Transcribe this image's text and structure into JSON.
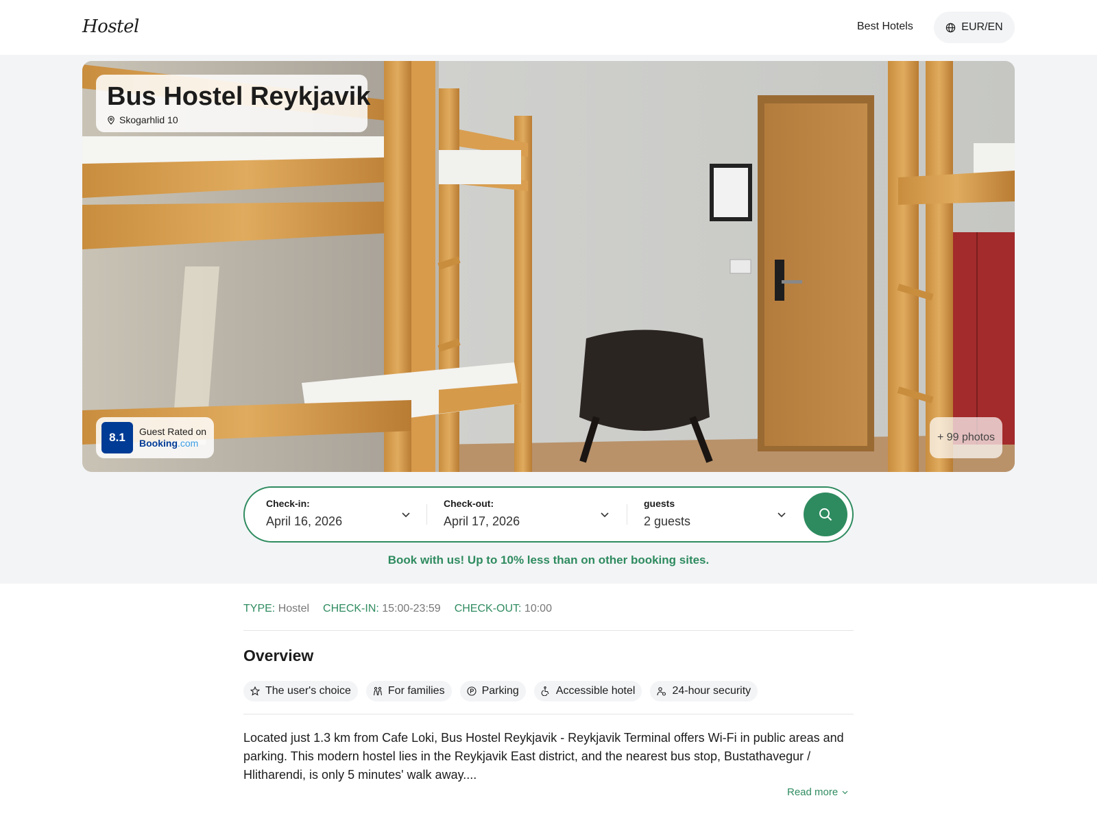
{
  "header": {
    "logo": "Hostel",
    "nav_link": "Best Hotels",
    "currency": "EUR/EN"
  },
  "hotel": {
    "name": "Bus Hostel Reykjavik",
    "address": "Skogarhlid 10",
    "rating_score": "8.1",
    "rating_label": "Guest Rated on",
    "rating_brand_main": "Booking",
    "rating_brand_suffix": ".com",
    "photos_label": "+ 99 photos"
  },
  "search": {
    "checkin_label": "Check-in:",
    "checkin_value": "April 16, 2026",
    "checkout_label": "Check-out:",
    "checkout_value": "April 17, 2026",
    "guests_label": "guests",
    "guests_value": "2 guests"
  },
  "promo": "Book with us! Up to 10% less than on other booking sites.",
  "meta": {
    "type_key": "TYPE:",
    "type_value": "Hostel",
    "checkin_key": "CHECK-IN:",
    "checkin_value": "15:00-23:59",
    "checkout_key": "CHECK-OUT:",
    "checkout_value": "10:00"
  },
  "overview": {
    "heading": "Overview",
    "tags": [
      {
        "label": "The user's choice",
        "icon": "star-icon"
      },
      {
        "label": "For families",
        "icon": "family-icon"
      },
      {
        "label": "Parking",
        "icon": "parking-icon"
      },
      {
        "label": "Accessible hotel",
        "icon": "accessible-icon"
      },
      {
        "label": "24-hour security",
        "icon": "security-icon"
      }
    ],
    "description": "Located just 1.3 km from Cafe Loki, Bus Hostel Reykjavik - Reykjavik Terminal offers Wi-Fi in public areas and parking. This modern hostel lies in the Reykjavik East district, and the nearest bus stop, Bustathavegur / Hlitharendi, is only 5 minutes' walk away....",
    "read_more": "Read more"
  },
  "colors": {
    "accent_green": "#2e8b5f",
    "booking_blue": "#003b95",
    "background_gray": "#f3f4f6"
  }
}
